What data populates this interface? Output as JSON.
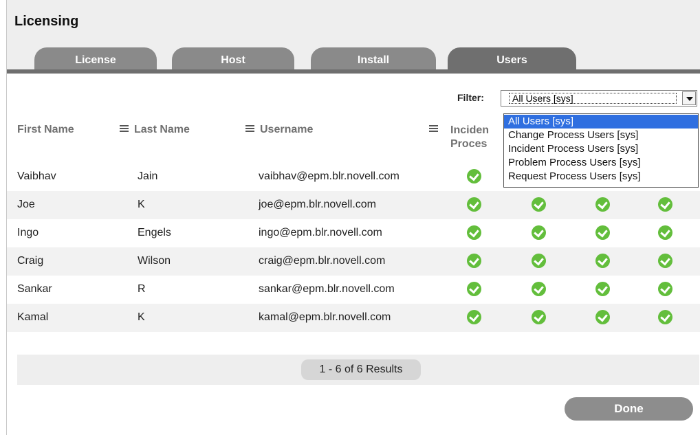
{
  "window": {
    "title": "Licensing"
  },
  "tabs": [
    {
      "label": "License",
      "active": false
    },
    {
      "label": "Host",
      "active": false
    },
    {
      "label": "Install",
      "active": false
    },
    {
      "label": "Users",
      "active": true
    }
  ],
  "filter": {
    "label": "Filter:",
    "selected": "All Users [sys]",
    "options": [
      "All Users [sys]",
      "Change Process Users [sys]",
      "Incident Process Users [sys]",
      "Problem Process Users [sys]",
      "Request Process Users [sys]"
    ]
  },
  "table": {
    "headers": {
      "first_name": "First Name",
      "last_name": "Last Name",
      "username": "Username",
      "incident_line1": "Inciden",
      "incident_line2": "Proces"
    },
    "rows": [
      {
        "first": "Vaibhav",
        "last": "Jain",
        "username": "vaibhav@epm.blr.novell.com"
      },
      {
        "first": "Joe",
        "last": "K",
        "username": "joe@epm.blr.novell.com"
      },
      {
        "first": "Ingo",
        "last": "Engels",
        "username": "ingo@epm.blr.novell.com"
      },
      {
        "first": "Craig",
        "last": "Wilson",
        "username": "craig@epm.blr.novell.com"
      },
      {
        "first": "Sankar",
        "last": "R",
        "username": "sankar@epm.blr.novell.com"
      },
      {
        "first": "Kamal",
        "last": "K",
        "username": "kamal@epm.blr.novell.com"
      }
    ],
    "status_icon": "check-circle-icon",
    "status_color": "#63be3c"
  },
  "pager": {
    "text": "1 - 6 of 6 Results"
  },
  "actions": {
    "done_label": "Done"
  }
}
